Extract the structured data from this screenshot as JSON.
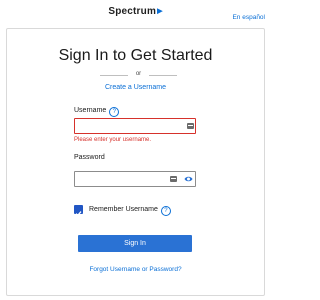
{
  "header": {
    "logo_text": "Spectrum",
    "logo_mark": "arrow-icon"
  },
  "language_link": "En español",
  "title": "Sign In to Get Started",
  "divider_text": "or",
  "create_username_link": "Create a Username",
  "username": {
    "label": "Username",
    "value": "",
    "error": "Please enter your username."
  },
  "password": {
    "label": "Password",
    "value": ""
  },
  "remember": {
    "label": "Remember Username",
    "checked": true
  },
  "signin_button": "Sign In",
  "forgot_link": "Forgot Username or Password?",
  "colors": {
    "accent": "#2a72d4",
    "error": "#d6312b",
    "link": "#0a6fd6"
  }
}
